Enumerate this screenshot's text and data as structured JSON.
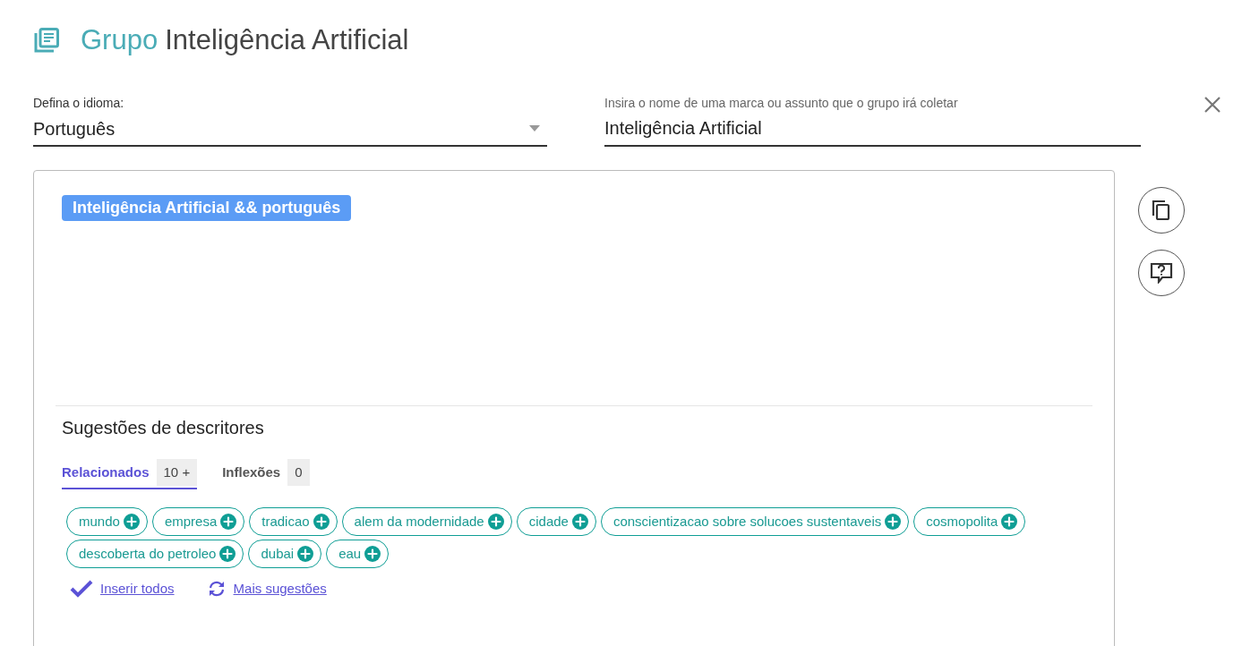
{
  "header": {
    "prefix": "Grupo",
    "title": "Inteligência Artificial"
  },
  "language": {
    "label": "Defina o idioma:",
    "value": "Português"
  },
  "subject": {
    "label": "Insira o nome de uma marca ou assunto que o grupo irá coletar",
    "value": "Inteligência Artificial"
  },
  "query_tag": "Inteligência Artificial && português",
  "suggestions": {
    "title": "Sugestões de descritores",
    "tabs": [
      {
        "label": "Relacionados",
        "count": "10 +",
        "selected": true
      },
      {
        "label": "Inflexões",
        "count": "0",
        "selected": false
      }
    ],
    "chips": [
      "mundo",
      "empresa",
      "tradicao",
      "alem da modernidade",
      "cidade",
      "conscientizacao sobre solucoes sustentaveis",
      "cosmopolita",
      "descoberta do petroleo",
      "dubai",
      "eau"
    ],
    "actions": [
      {
        "kind": "insert",
        "label": "Inserir todos"
      },
      {
        "kind": "more",
        "label": "Mais sugestões"
      }
    ]
  }
}
